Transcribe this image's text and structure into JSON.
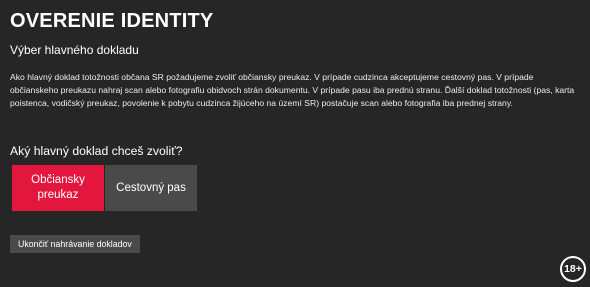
{
  "page": {
    "title": "OVERENIE IDENTITY",
    "subtitle": "Výber hlavného dokladu",
    "description": "Ako hlavný doklad totožnosti občana SR požadujeme zvoliť občiansky preukaz. V prípade cudzinca akceptujeme cestovný pas. V prípade občianskeho preukazu nahraj scan alebo fotografiu obidvoch strán dokumentu. V prípade pasu iba prednú stranu. Ďalší doklad totožnosti (pas, karta poistenca, vodičský preukaz, povolenie k pobytu cudzinca žijúceho na území SR) postačuje scan alebo fotografia iba prednej strany."
  },
  "question": {
    "label": "Aký hlavný doklad chceš zvoliť?",
    "options": [
      "Občiansky preukaz",
      "Cestovný pas"
    ],
    "selected": "Občiansky preukaz"
  },
  "actions": {
    "end_label": "Ukončiť nahrávanie dokladov"
  },
  "badge": {
    "label": "18+"
  },
  "colors": {
    "background": "#262626",
    "accent": "#e3173d",
    "secondary_button": "#4a4a4a"
  }
}
